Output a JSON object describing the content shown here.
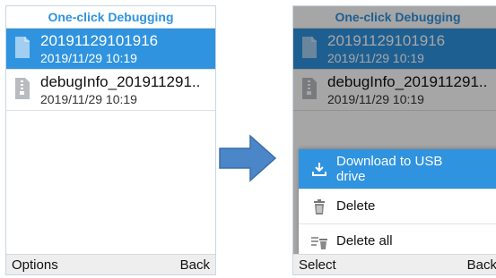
{
  "before": {
    "title": "One-click Debugging",
    "files": [
      {
        "name": "20191129101916",
        "date": "2019/11/29  10:19",
        "icon": "file-icon",
        "selected": true
      },
      {
        "name": "debugInfo_201911291..",
        "date": "2019/11/29  10:19",
        "icon": "zip-file-icon",
        "selected": false
      }
    ],
    "softkeys": {
      "left": "Options",
      "right": "Back"
    }
  },
  "after": {
    "title": "One-click Debugging",
    "files": [
      {
        "name": "20191129101916",
        "date": "2019/11/29  10:19",
        "icon": "file-icon",
        "selected": true
      },
      {
        "name": "debugInfo_201911291..",
        "date": "2019/11/29  10:19",
        "icon": "zip-file-icon",
        "selected": false
      }
    ],
    "menu": [
      {
        "label": "Download to USB drive",
        "icon": "download-icon",
        "selected": true
      },
      {
        "label": "Delete",
        "icon": "trash-icon",
        "selected": false
      },
      {
        "label": "Delete all",
        "icon": "delete-all-icon",
        "selected": false
      }
    ],
    "softkeys": {
      "left": "Select",
      "right": "Back"
    }
  },
  "arrow_icon": "right-arrow-icon",
  "colors": {
    "accent": "#2f93df",
    "arrow": "#4a86c8"
  }
}
